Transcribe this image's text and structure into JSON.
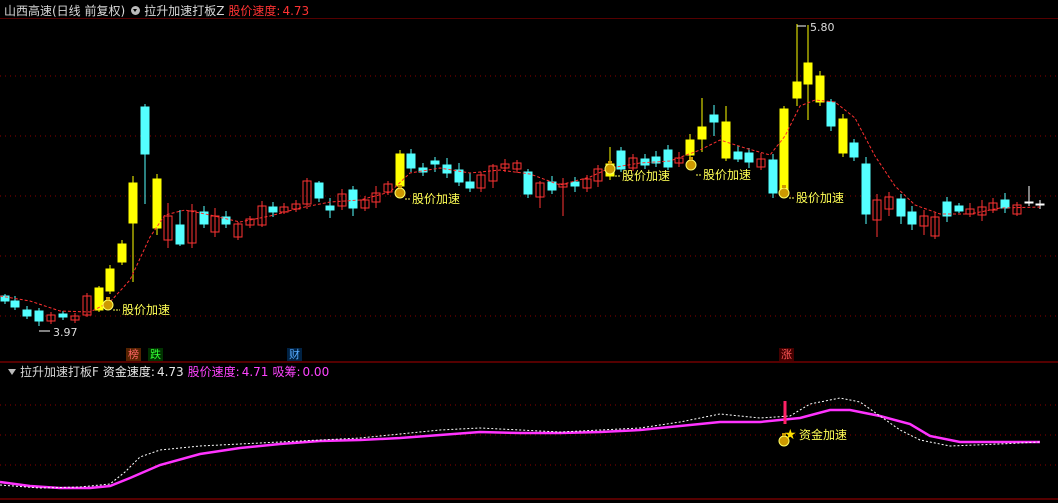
{
  "header": {
    "title": "山西高速(日线 前复权)",
    "indicator_name": "拉升加速打板Z",
    "speed_label": "股价速度:",
    "speed_value": "4.73"
  },
  "sub_header": {
    "indicator_name": "拉升加速打板F",
    "fund_label": "资金速度:",
    "fund_value": "4.73",
    "price_label": "股价速度:",
    "price_value": "4.71",
    "absorb_label": "吸筹:",
    "absorb_value": "0.00"
  },
  "colors": {
    "up_yellow": "#ffff00",
    "down_cyan": "#54ffff",
    "red_candle": "#ff3333",
    "ma_red": "#ff3030",
    "magenta": "#ff33ff",
    "grid": "#8a0000",
    "label_yellow": "#ffff55"
  },
  "annotations": {
    "high_label": "5.80",
    "low_label": "3.97",
    "signal_text": "股价加速",
    "fund_signal_text": "资金加速",
    "money_icon": "money-bag-icon",
    "star_icon": "star-icon"
  },
  "badges": [
    {
      "text": "榜",
      "color": "#ff6666",
      "bg": "#552200"
    },
    {
      "text": "跌",
      "color": "#33ff33",
      "bg": "#003300"
    },
    {
      "text": "财",
      "color": "#55aaff",
      "bg": "#002244"
    },
    {
      "text": "涨",
      "color": "#ff5555",
      "bg": "#440000"
    }
  ]
}
